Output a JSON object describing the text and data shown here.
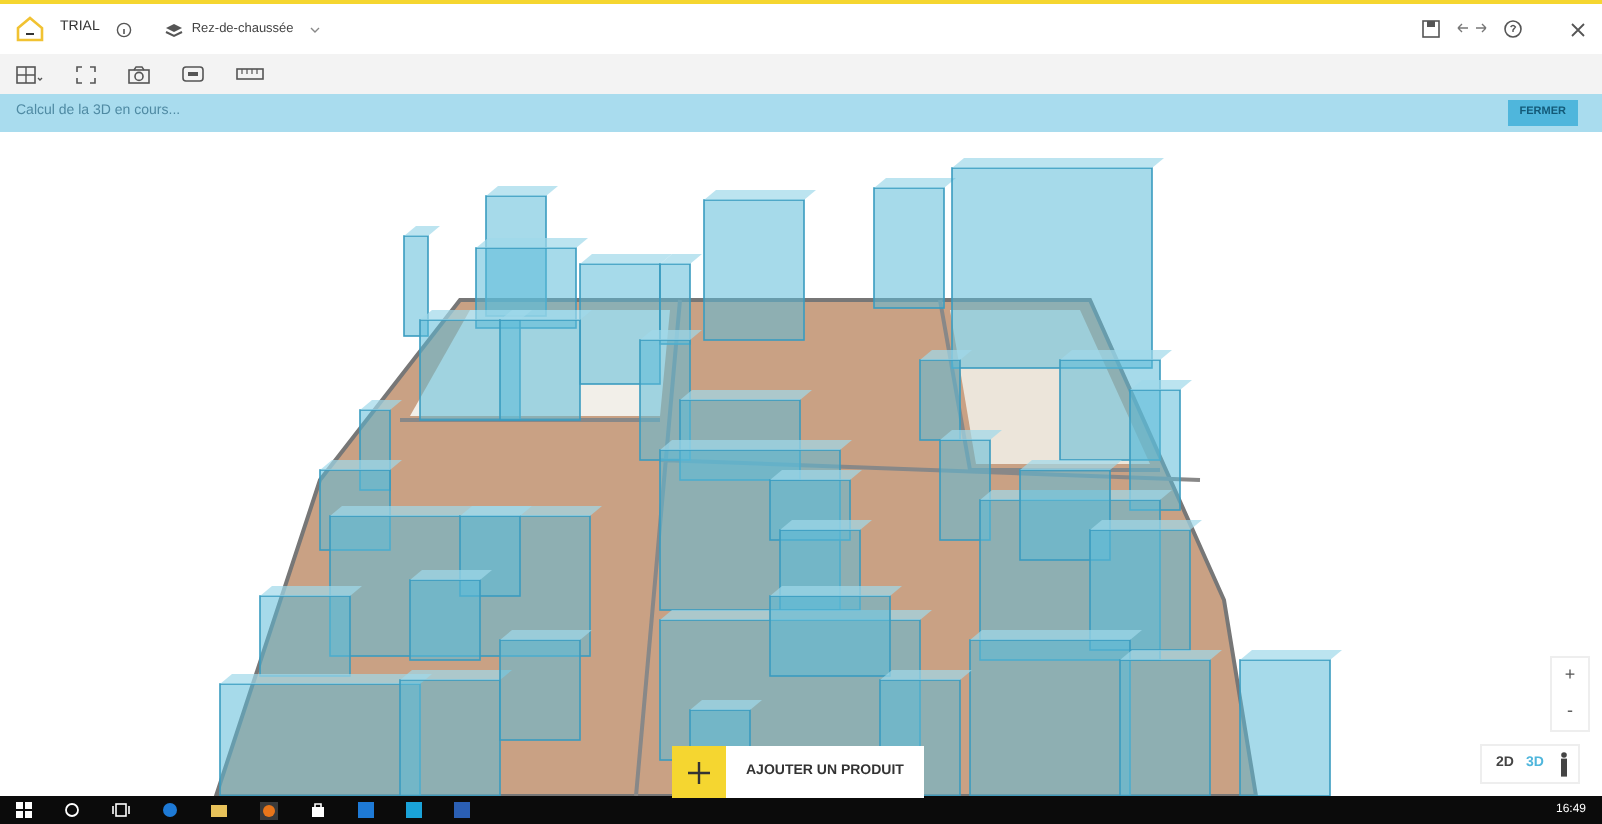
{
  "header": {
    "title": "TRIAL",
    "level": "Rez-de-chaussée"
  },
  "banner": {
    "text": "Calcul de la 3D en cours...",
    "button": "FERMER"
  },
  "zoom_controls": [
    "+",
    "-"
  ],
  "view_modes": [
    {
      "label": "2D",
      "selected": false
    },
    {
      "label": "3D",
      "selected": true
    }
  ],
  "add_button": {
    "label": "AJOUTER UN PRODUIT"
  },
  "taskbar": {
    "clock": "16:49"
  }
}
